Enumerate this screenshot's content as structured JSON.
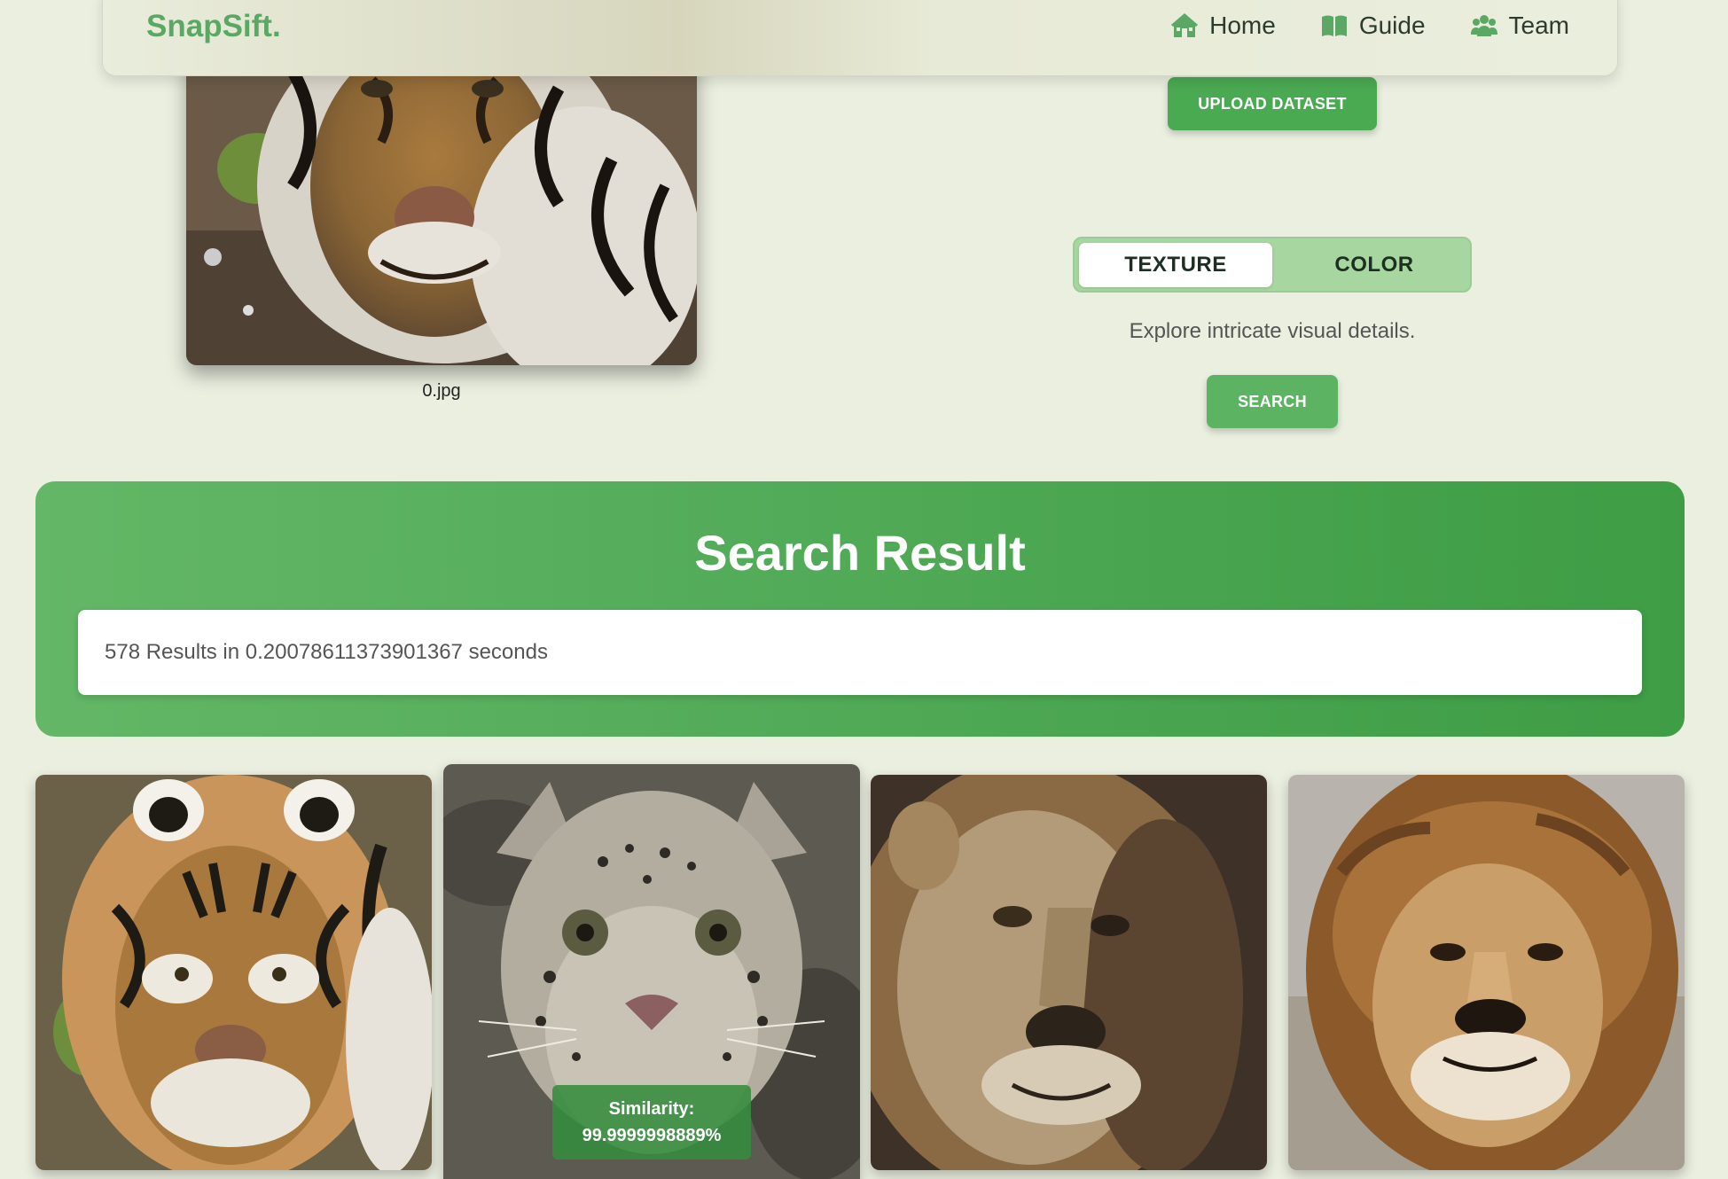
{
  "navbar": {
    "brand": "SnapSift.",
    "links": [
      {
        "label": "Home",
        "icon": "house-icon"
      },
      {
        "label": "Guide",
        "icon": "book-icon"
      },
      {
        "label": "Team",
        "icon": "people-icon"
      }
    ]
  },
  "query": {
    "filename": "0.jpg"
  },
  "controls": {
    "upload_label": "UPLOAD DATASET",
    "toggle": {
      "active": "TEXTURE",
      "inactive": "COLOR"
    },
    "description": "Explore intricate visual details.",
    "search_label": "SEARCH"
  },
  "results": {
    "title": "Search Result",
    "summary": "578 Results in 0.20078611373901367 seconds",
    "cards": [
      {
        "subject": "tiger"
      },
      {
        "subject": "snow leopard",
        "similarity_label": "Similarity:",
        "similarity_value": "99.9999998889%"
      },
      {
        "subject": "lion"
      },
      {
        "subject": "lion"
      }
    ]
  },
  "colors": {
    "accent": "#4aaa52",
    "brand": "#5aa863",
    "background": "#ebefe0"
  }
}
